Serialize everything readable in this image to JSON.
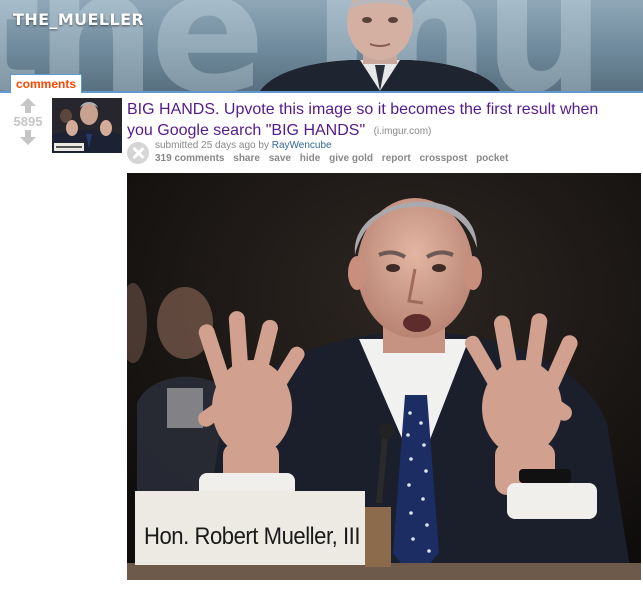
{
  "subreddit": {
    "name": "THE_MUELLER"
  },
  "tabs": {
    "active": "comments"
  },
  "post": {
    "score": "5895",
    "title": "BIG HANDS. Upvote this image so it becomes the first result when you Google search \"BIG HANDS\"",
    "domain": "(i.imgur.com)",
    "submitted_prefix": "submitted 25 days ago by",
    "author": "RayWencube",
    "actions": {
      "comments": "319 comments",
      "share": "share",
      "save": "save",
      "hide": "hide",
      "give_gold": "give gold",
      "report": "report",
      "crosspost": "crosspost",
      "pocket": "pocket"
    },
    "image_nameplate": "Hon. Robert Mueller, III"
  },
  "colors": {
    "title_link": "#551a8b",
    "tab_text": "#ff4500",
    "tab_border": "#5f99cf",
    "meta_text": "#888888",
    "author_link": "#336699",
    "vote_arrow": "#c6c6c6"
  },
  "icons": [
    "upvote-arrow-icon",
    "downvote-arrow-icon",
    "close-expando-icon"
  ]
}
